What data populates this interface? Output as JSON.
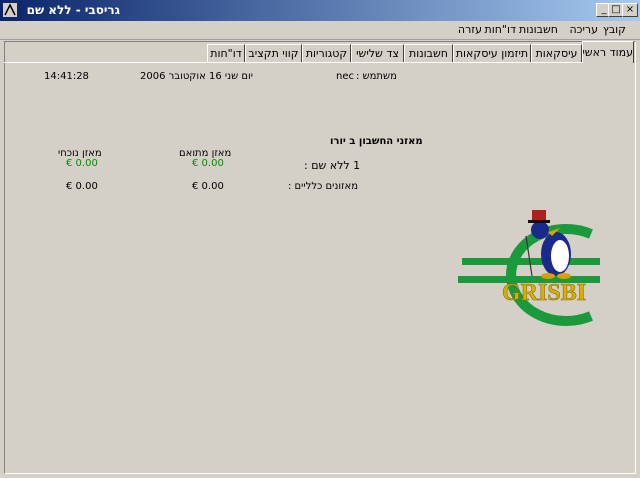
{
  "window": {
    "title": "גריסבי - ללא שם"
  },
  "title_buttons": {
    "minimize": "_",
    "maximize": "□",
    "close": "×"
  },
  "menu": [
    "קובץ",
    "עריכה",
    "חשבונות",
    "דו\"חות",
    "עזרה"
  ],
  "tabs": [
    "עמוד ראשי",
    "עיסקאות",
    "תיזמון עיסקאות",
    "חשבונות",
    "צד שלישי",
    "קטגוריות",
    "קווי תקציב",
    "דו\"חות"
  ],
  "active_tab": 0,
  "header": {
    "time": "14:41:28",
    "date": "יום שני 16 אוקטובר 2006",
    "user_label": "משתמש :",
    "user_name": "nec"
  },
  "balances": {
    "section_title": "מאזני החשבון ב יורו",
    "current_label": "מאזן נוכחי",
    "reconciled_label": "מאזן מתואם",
    "accounts": [
      {
        "name": "1 ללא שם :",
        "current": "€ 0.00",
        "reconciled": "€ 0.00"
      }
    ],
    "totals_label": "מאזונים כלליים :",
    "total_current": "€ 0.00",
    "total_reconciled": "€ 0.00"
  },
  "logo": {
    "text": "GRISBI"
  },
  "colors": {
    "positive_balance": "#0a8a0a",
    "title_gradient_start": "#0a246a",
    "logo_green": "#1a9a3a",
    "logo_gold": "#d8b000"
  }
}
